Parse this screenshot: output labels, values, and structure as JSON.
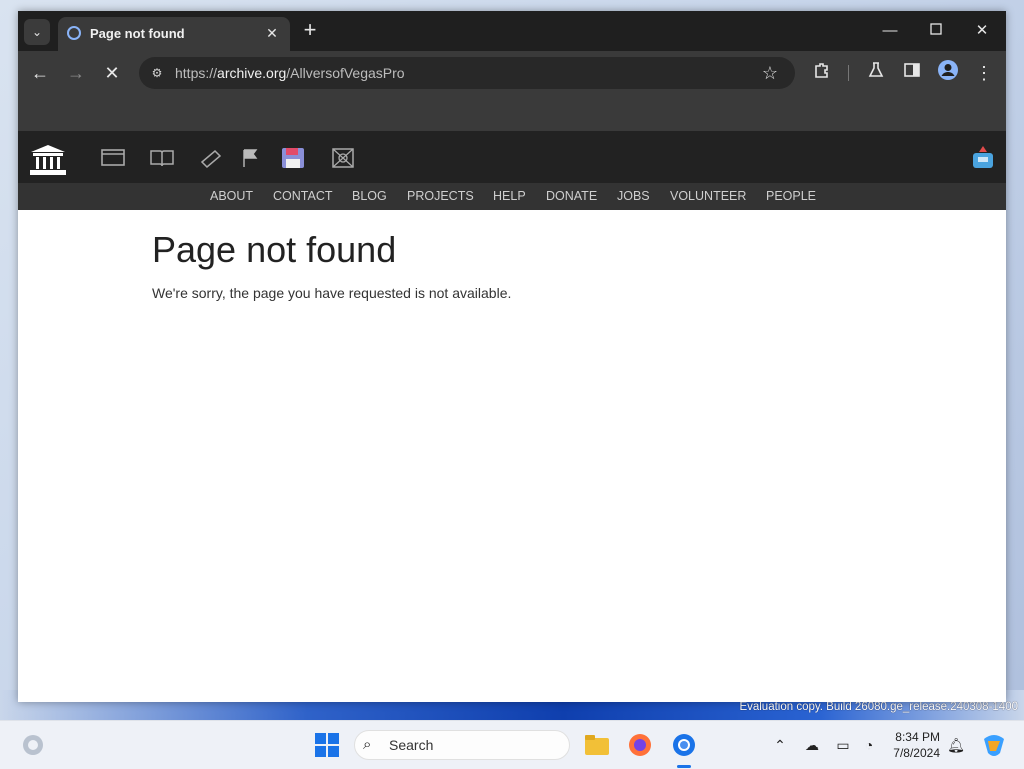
{
  "browser": {
    "tab": {
      "title": "Page not found"
    },
    "url": {
      "prefix": "https://",
      "domain": "archive.org",
      "path": "/AllversofVegasPro"
    }
  },
  "site": {
    "nav": [
      "ABOUT",
      "CONTACT",
      "BLOG",
      "PROJECTS",
      "HELP",
      "DONATE",
      "JOBS",
      "VOLUNTEER",
      "PEOPLE"
    ],
    "headline": "Page not found",
    "message": "We're sorry, the page you have requested is not available."
  },
  "desktop": {
    "watermark": "Evaluation copy. Build 26080.ge_release.240308-1400"
  },
  "taskbar": {
    "search_label": "Search",
    "time": "8:34 PM",
    "date": "7/8/2024"
  }
}
